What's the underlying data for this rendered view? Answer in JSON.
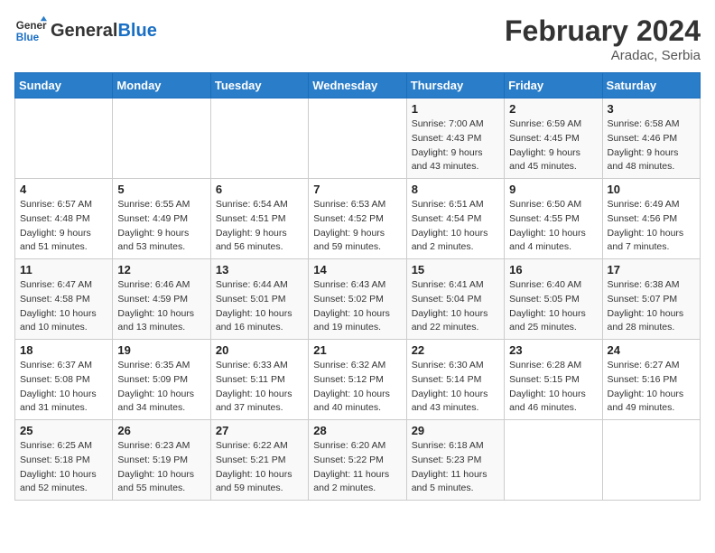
{
  "header": {
    "logo_line1": "General",
    "logo_line2": "Blue",
    "month_title": "February 2024",
    "location": "Aradac, Serbia"
  },
  "weekdays": [
    "Sunday",
    "Monday",
    "Tuesday",
    "Wednesday",
    "Thursday",
    "Friday",
    "Saturday"
  ],
  "weeks": [
    [
      {
        "day": "",
        "info": ""
      },
      {
        "day": "",
        "info": ""
      },
      {
        "day": "",
        "info": ""
      },
      {
        "day": "",
        "info": ""
      },
      {
        "day": "1",
        "info": "Sunrise: 7:00 AM\nSunset: 4:43 PM\nDaylight: 9 hours\nand 43 minutes."
      },
      {
        "day": "2",
        "info": "Sunrise: 6:59 AM\nSunset: 4:45 PM\nDaylight: 9 hours\nand 45 minutes."
      },
      {
        "day": "3",
        "info": "Sunrise: 6:58 AM\nSunset: 4:46 PM\nDaylight: 9 hours\nand 48 minutes."
      }
    ],
    [
      {
        "day": "4",
        "info": "Sunrise: 6:57 AM\nSunset: 4:48 PM\nDaylight: 9 hours\nand 51 minutes."
      },
      {
        "day": "5",
        "info": "Sunrise: 6:55 AM\nSunset: 4:49 PM\nDaylight: 9 hours\nand 53 minutes."
      },
      {
        "day": "6",
        "info": "Sunrise: 6:54 AM\nSunset: 4:51 PM\nDaylight: 9 hours\nand 56 minutes."
      },
      {
        "day": "7",
        "info": "Sunrise: 6:53 AM\nSunset: 4:52 PM\nDaylight: 9 hours\nand 59 minutes."
      },
      {
        "day": "8",
        "info": "Sunrise: 6:51 AM\nSunset: 4:54 PM\nDaylight: 10 hours\nand 2 minutes."
      },
      {
        "day": "9",
        "info": "Sunrise: 6:50 AM\nSunset: 4:55 PM\nDaylight: 10 hours\nand 4 minutes."
      },
      {
        "day": "10",
        "info": "Sunrise: 6:49 AM\nSunset: 4:56 PM\nDaylight: 10 hours\nand 7 minutes."
      }
    ],
    [
      {
        "day": "11",
        "info": "Sunrise: 6:47 AM\nSunset: 4:58 PM\nDaylight: 10 hours\nand 10 minutes."
      },
      {
        "day": "12",
        "info": "Sunrise: 6:46 AM\nSunset: 4:59 PM\nDaylight: 10 hours\nand 13 minutes."
      },
      {
        "day": "13",
        "info": "Sunrise: 6:44 AM\nSunset: 5:01 PM\nDaylight: 10 hours\nand 16 minutes."
      },
      {
        "day": "14",
        "info": "Sunrise: 6:43 AM\nSunset: 5:02 PM\nDaylight: 10 hours\nand 19 minutes."
      },
      {
        "day": "15",
        "info": "Sunrise: 6:41 AM\nSunset: 5:04 PM\nDaylight: 10 hours\nand 22 minutes."
      },
      {
        "day": "16",
        "info": "Sunrise: 6:40 AM\nSunset: 5:05 PM\nDaylight: 10 hours\nand 25 minutes."
      },
      {
        "day": "17",
        "info": "Sunrise: 6:38 AM\nSunset: 5:07 PM\nDaylight: 10 hours\nand 28 minutes."
      }
    ],
    [
      {
        "day": "18",
        "info": "Sunrise: 6:37 AM\nSunset: 5:08 PM\nDaylight: 10 hours\nand 31 minutes."
      },
      {
        "day": "19",
        "info": "Sunrise: 6:35 AM\nSunset: 5:09 PM\nDaylight: 10 hours\nand 34 minutes."
      },
      {
        "day": "20",
        "info": "Sunrise: 6:33 AM\nSunset: 5:11 PM\nDaylight: 10 hours\nand 37 minutes."
      },
      {
        "day": "21",
        "info": "Sunrise: 6:32 AM\nSunset: 5:12 PM\nDaylight: 10 hours\nand 40 minutes."
      },
      {
        "day": "22",
        "info": "Sunrise: 6:30 AM\nSunset: 5:14 PM\nDaylight: 10 hours\nand 43 minutes."
      },
      {
        "day": "23",
        "info": "Sunrise: 6:28 AM\nSunset: 5:15 PM\nDaylight: 10 hours\nand 46 minutes."
      },
      {
        "day": "24",
        "info": "Sunrise: 6:27 AM\nSunset: 5:16 PM\nDaylight: 10 hours\nand 49 minutes."
      }
    ],
    [
      {
        "day": "25",
        "info": "Sunrise: 6:25 AM\nSunset: 5:18 PM\nDaylight: 10 hours\nand 52 minutes."
      },
      {
        "day": "26",
        "info": "Sunrise: 6:23 AM\nSunset: 5:19 PM\nDaylight: 10 hours\nand 55 minutes."
      },
      {
        "day": "27",
        "info": "Sunrise: 6:22 AM\nSunset: 5:21 PM\nDaylight: 10 hours\nand 59 minutes."
      },
      {
        "day": "28",
        "info": "Sunrise: 6:20 AM\nSunset: 5:22 PM\nDaylight: 11 hours\nand 2 minutes."
      },
      {
        "day": "29",
        "info": "Sunrise: 6:18 AM\nSunset: 5:23 PM\nDaylight: 11 hours\nand 5 minutes."
      },
      {
        "day": "",
        "info": ""
      },
      {
        "day": "",
        "info": ""
      }
    ]
  ]
}
